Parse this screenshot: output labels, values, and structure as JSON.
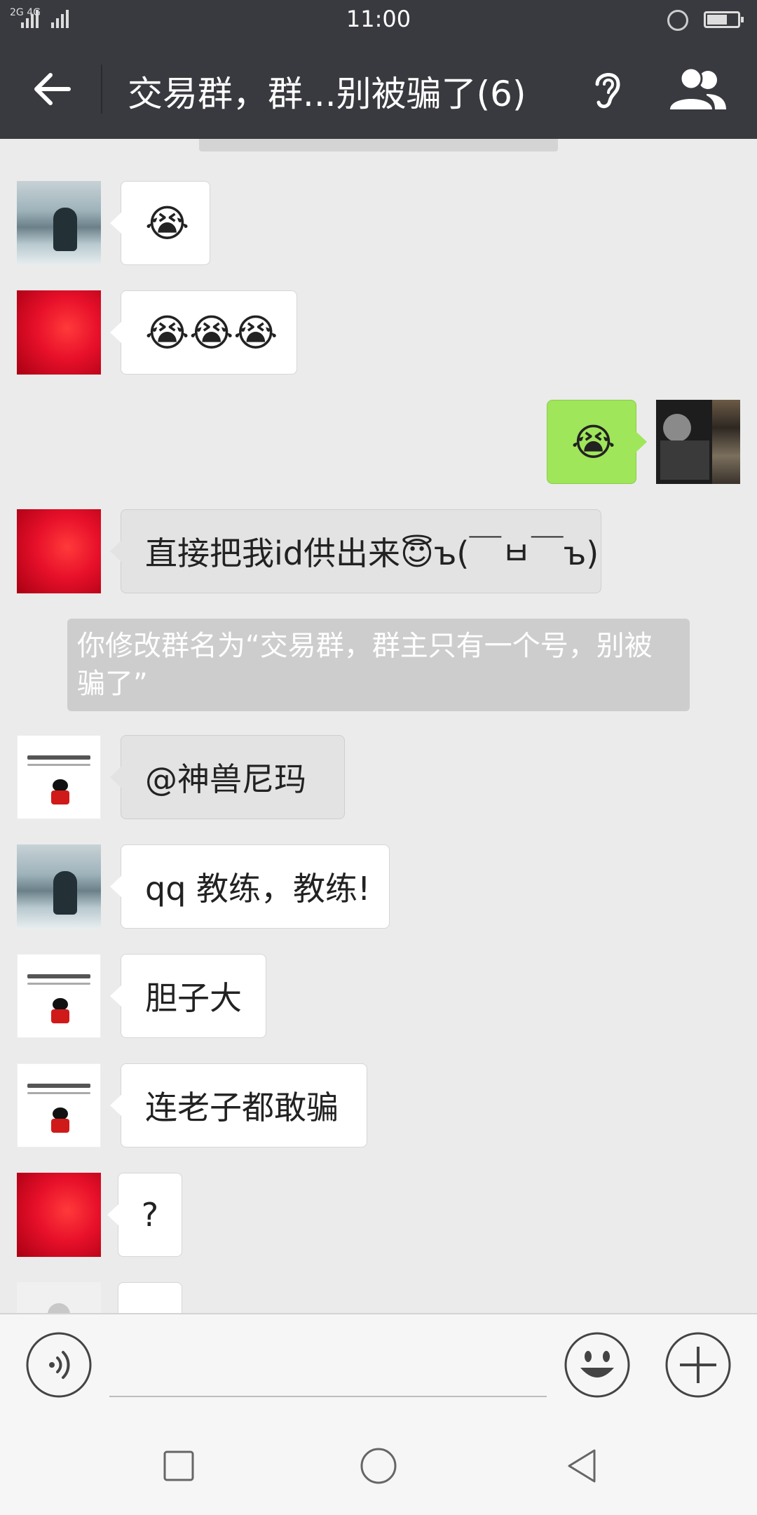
{
  "status_bar": {
    "time": "11:00",
    "network": "2G 4G"
  },
  "header": {
    "title": "交易群，群...别被骗了(6)"
  },
  "messages": [
    {
      "side": "left",
      "avatar": "lake-avatar",
      "text": "😭",
      "style": "white"
    },
    {
      "side": "left",
      "avatar": "red-avatar",
      "text": "😭😭😭",
      "style": "white"
    },
    {
      "side": "right",
      "avatar": "self-avatar",
      "text": "😭",
      "style": "green"
    },
    {
      "side": "left",
      "avatar": "red-avatar",
      "text": "直接把我id供出来😇ъ(￣ㅂ￣ъ)",
      "style": "grey"
    },
    {
      "side": "left",
      "avatar": "text-avatar",
      "text": "@神兽尼玛",
      "style": "grey"
    },
    {
      "side": "left",
      "avatar": "lake-avatar",
      "text": "qq 教练，教练!",
      "style": "white"
    },
    {
      "side": "left",
      "avatar": "text-avatar",
      "text": "胆子大",
      "style": "white"
    },
    {
      "side": "left",
      "avatar": "text-avatar",
      "text": "连老子都敢骗",
      "style": "white"
    },
    {
      "side": "left",
      "avatar": "red-avatar",
      "text": "?",
      "style": "white"
    }
  ],
  "system_message": {
    "text": "你修改群名为“交易群，群主只有一个号，别被骗了”"
  },
  "colors": {
    "header_bg": "#393a3f",
    "chat_bg": "#ebebeb",
    "self_bubble": "#9fe65a",
    "system_bg": "#cdcdcd"
  },
  "icons": {
    "back": "arrow-left-icon",
    "ear": "ear-icon",
    "group": "group-people-icon",
    "voice": "voice-icon",
    "emoji": "emoji-smile-icon",
    "plus": "plus-icon",
    "nav_recent": "square-nav-icon",
    "nav_home": "circle-nav-icon",
    "nav_back": "triangle-back-nav-icon"
  }
}
